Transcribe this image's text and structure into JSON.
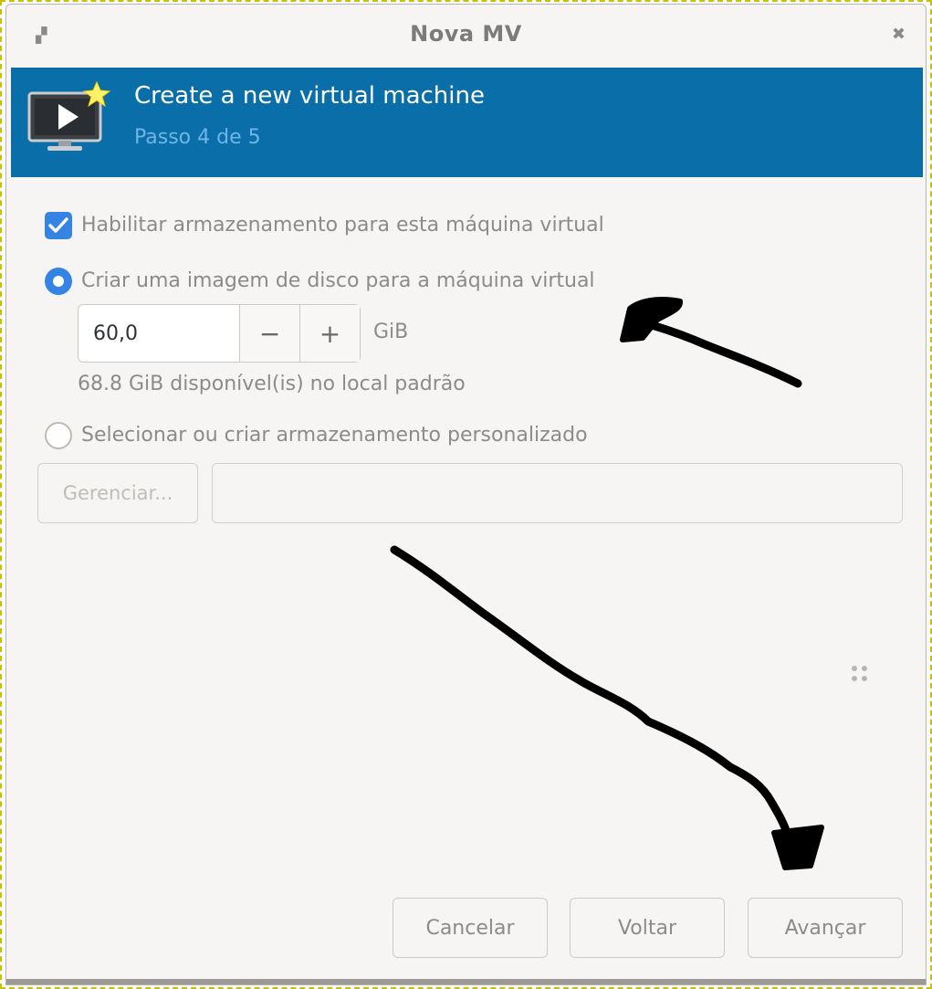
{
  "window": {
    "title": "Nova MV",
    "left_glyph": "▞",
    "close_glyph": "✖"
  },
  "header": {
    "title": "Create a new virtual machine",
    "step": "Passo 4 de 5",
    "icon": "vm-monitor-icon"
  },
  "storage": {
    "enable_label": "Habilitar armazenamento para esta máquina virtual",
    "enable_checked": true,
    "create_image_label": "Criar uma imagem de disco para a máquina virtual",
    "create_image_selected": true,
    "size_value": "60,0",
    "decrement": "−",
    "increment": "+",
    "unit": "GiB",
    "available": "68.8 GiB disponível(is) no local padrão",
    "custom_label": "Selecionar ou criar armazenamento personalizado",
    "custom_selected": false,
    "manage_button": "Gerenciar...",
    "path_value": ""
  },
  "footer": {
    "cancel": "Cancelar",
    "back": "Voltar",
    "next": "Avançar"
  },
  "colors": {
    "banner": "#0a6fa8",
    "accent": "#3584e4",
    "annotation": "#000000"
  }
}
